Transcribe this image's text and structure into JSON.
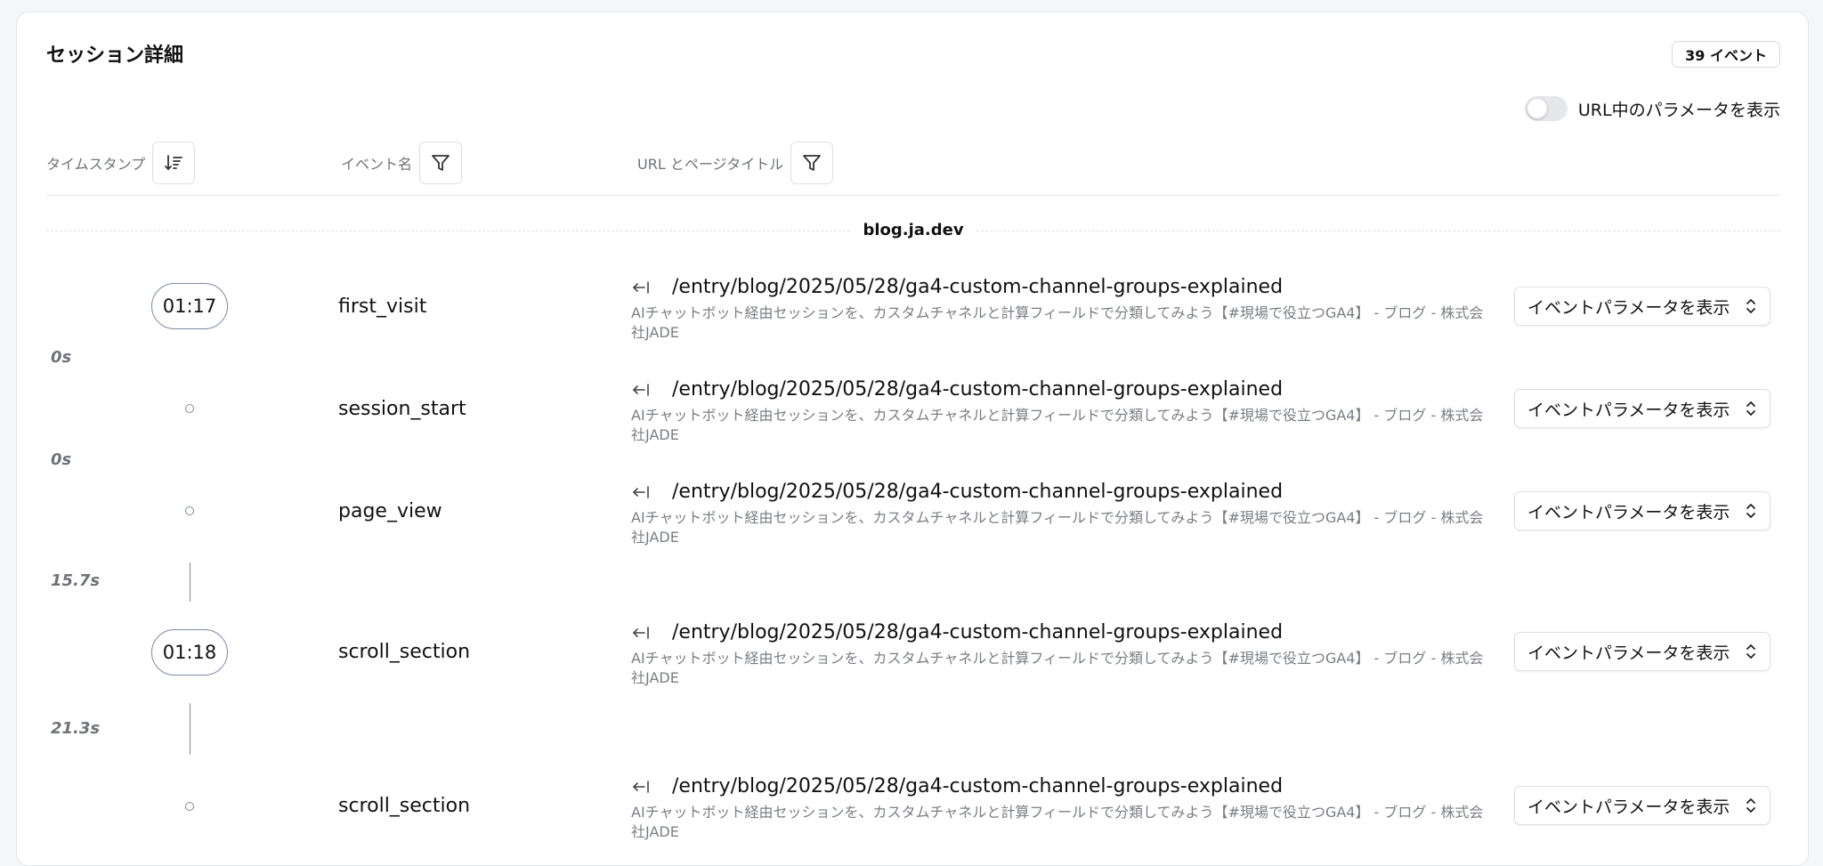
{
  "header": {
    "title": "セッション詳細",
    "event_count": "39 イベント",
    "param_toggle_label": "URL中のパラメータを表示",
    "param_toggle_on": false
  },
  "columns": {
    "timestamp": "タイムスタンプ",
    "event_name": "イベント名",
    "url_title": "URL とページタイトル"
  },
  "domain": "blog.ja.dev",
  "timeline": {
    "times": [
      "01:17",
      "01:18"
    ],
    "durations": [
      "0s",
      "0s",
      "15.7s",
      "21.3s"
    ]
  },
  "events": [
    {
      "name": "first_visit",
      "url": "/entry/blog/2025/05/28/ga4-custom-channel-groups-explained",
      "page_title_line1": "AIチャットボット経由セッションを、カスタムチャネルと計算フィールドで分類してみよう【#現場で役立つGA4】 - ブログ - 株式会",
      "page_title_line2": "社JADE",
      "param_select": "イベントパラメータを表示"
    },
    {
      "name": "session_start",
      "url": "/entry/blog/2025/05/28/ga4-custom-channel-groups-explained",
      "page_title_line1": "AIチャットボット経由セッションを、カスタムチャネルと計算フィールドで分類してみよう【#現場で役立つGA4】 - ブログ - 株式会",
      "page_title_line2": "社JADE",
      "param_select": "イベントパラメータを表示"
    },
    {
      "name": "page_view",
      "url": "/entry/blog/2025/05/28/ga4-custom-channel-groups-explained",
      "page_title_line1": "AIチャットボット経由セッションを、カスタムチャネルと計算フィールドで分類してみよう【#現場で役立つGA4】 - ブログ - 株式会",
      "page_title_line2": "社JADE",
      "param_select": "イベントパラメータを表示"
    },
    {
      "name": "scroll_section",
      "url": "/entry/blog/2025/05/28/ga4-custom-channel-groups-explained",
      "page_title_line1": "AIチャットボット経由セッションを、カスタムチャネルと計算フィールドで分類してみよう【#現場で役立つGA4】 - ブログ - 株式会",
      "page_title_line2": "社JADE",
      "param_select": "イベントパラメータを表示"
    },
    {
      "name": "scroll_section",
      "url": "/entry/blog/2025/05/28/ga4-custom-channel-groups-explained",
      "page_title_line1": "AIチャットボット経由セッションを、カスタムチャネルと計算フィールドで分類してみよう【#現場で役立つGA4】 - ブログ - 株式会",
      "page_title_line2": "社JADE",
      "param_select": "イベントパラメータを表示"
    }
  ]
}
